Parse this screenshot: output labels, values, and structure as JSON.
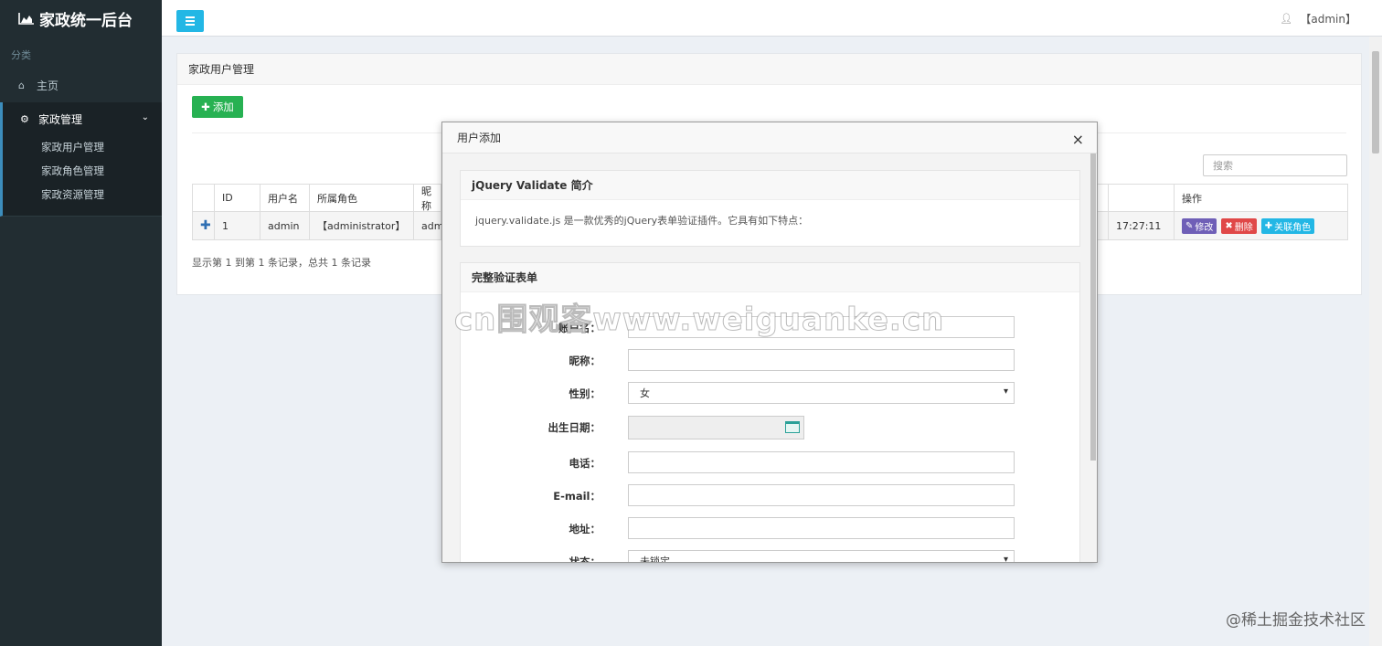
{
  "app": {
    "title": "家政统一后台"
  },
  "sidebar": {
    "section_label": "分类",
    "home_label": "主页",
    "group_label": "家政管理",
    "sub_items": [
      {
        "label": "家政用户管理"
      },
      {
        "label": "家政角色管理"
      },
      {
        "label": "家政资源管理"
      }
    ]
  },
  "topbar": {
    "user_label": "【admin】"
  },
  "panel": {
    "title": "家政用户管理",
    "add_label": "添加",
    "search_placeholder": "搜索",
    "columns": [
      "ID",
      "用户名",
      "所属角色",
      "昵称",
      "操作"
    ],
    "row": {
      "id": "1",
      "username": "admin",
      "role": "【administrator】",
      "nickname": "admi",
      "time": "17:27:11",
      "edit_label": "修改",
      "delete_label": "删除",
      "role_label": "关联角色"
    },
    "footer": "显示第 1 到第 1 条记录，总共 1 条记录"
  },
  "modal": {
    "title": "用户添加",
    "close": "×",
    "intro": {
      "title": "jQuery Validate 简介",
      "text": "jquery.validate.js 是一款优秀的jQuery表单验证插件。它具有如下特点："
    },
    "form": {
      "title": "完整验证表单",
      "fields": [
        {
          "label": "账户名：",
          "value": ""
        },
        {
          "label": "昵称：",
          "value": ""
        },
        {
          "label": "性别：",
          "value": "女"
        },
        {
          "label": "出生日期：",
          "value": ""
        },
        {
          "label": "电话：",
          "value": ""
        },
        {
          "label": "E-mail：",
          "value": ""
        },
        {
          "label": "地址：",
          "value": ""
        },
        {
          "label": "状态：",
          "value": "未锁定"
        }
      ]
    }
  },
  "watermark": "cn围观客www.weiguanke.cn",
  "corner_mark": "@稀土掘金技术社区"
}
